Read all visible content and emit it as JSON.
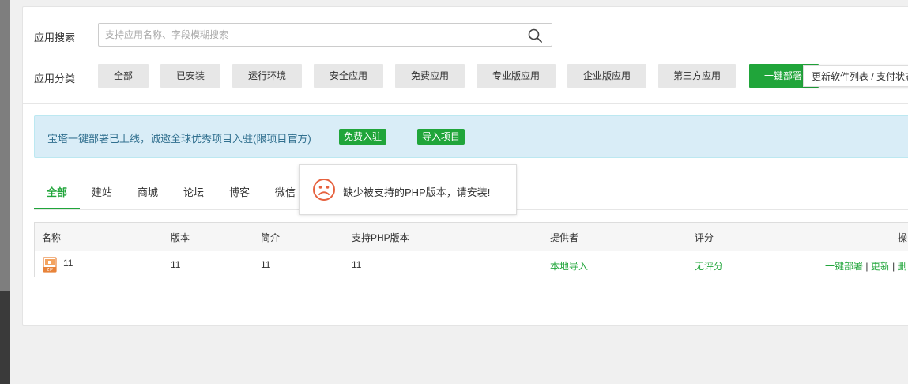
{
  "search": {
    "label": "应用搜索",
    "placeholder": "支持应用名称、字段模糊搜索"
  },
  "categories": {
    "label": "应用分类",
    "items": [
      "全部",
      "已安装",
      "运行环境",
      "安全应用",
      "免费应用",
      "专业版应用",
      "企业版应用",
      "第三方应用"
    ],
    "deploy_label": "一键部署",
    "update_label": "更新软件列表 / 支付状态"
  },
  "banner": {
    "text": "宝塔一键部署已上线，诚邀全球优秀项目入驻(限项目官方)",
    "join_label": "免费入驻",
    "import_label": "导入项目"
  },
  "tabs": [
    "全部",
    "建站",
    "商城",
    "论坛",
    "博客",
    "微信"
  ],
  "table": {
    "headers": [
      "名称",
      "版本",
      "简介",
      "支持PHP版本",
      "提供者",
      "评分",
      "操"
    ],
    "rows": [
      {
        "name": "11",
        "version": "11",
        "desc": "11",
        "php": "11",
        "provider": "本地导入",
        "rating": "无评分",
        "actions": [
          "一键部署",
          "更新",
          "删"
        ]
      }
    ],
    "action_sep": " | "
  },
  "toast": {
    "message": "缺少被支持的PHP版本，请安装!"
  },
  "colors": {
    "accent": "#20a53a",
    "banner_bg": "#d9edf7",
    "banner_text": "#31708f",
    "toast_icon": "#e6623f"
  }
}
